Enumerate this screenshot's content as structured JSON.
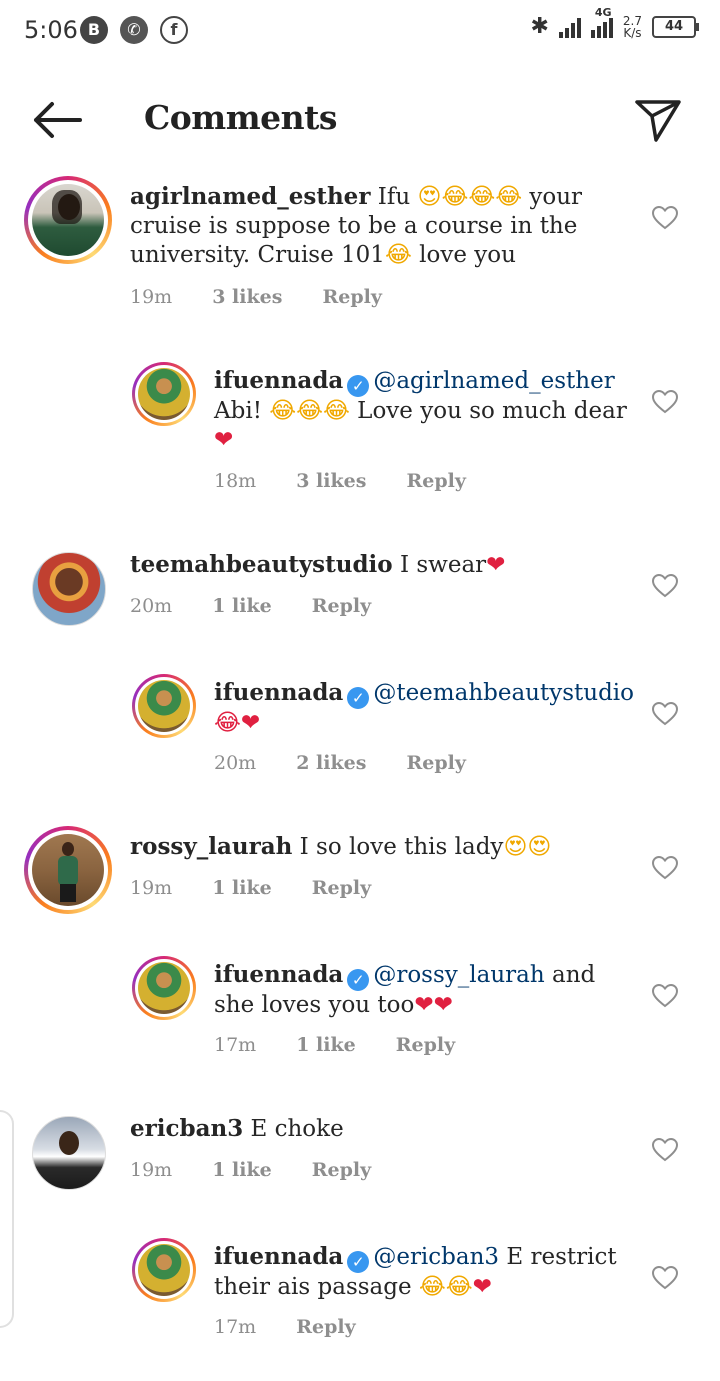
{
  "status_bar": {
    "time": "5:06",
    "icons": [
      "b-badge-icon",
      "whatsapp-icon",
      "facebook-icon"
    ],
    "network_label": "4G",
    "speed": "2.7",
    "speed_unit": "K/s",
    "battery": "44"
  },
  "header": {
    "title": "Comments"
  },
  "comments": [
    {
      "username": "agirlnamed_esther",
      "text_1": "Ifu ",
      "emoji_1": "😍😂😂😂",
      "text_2": " your cruise is suppose to be a course in the university. Cruise 101",
      "emoji_2": "😂",
      "text_3": " love you",
      "time": "19m",
      "likes": "3 likes",
      "reply": "Reply"
    },
    {
      "username": "ifuennada",
      "mention": "@agirlnamed_esther",
      "text_1": "Abi! ",
      "emoji_1": "😂😂😂",
      "text_2": " Love you so much dear ",
      "emoji_2": "❤",
      "time": "18m",
      "likes": "3 likes",
      "reply": "Reply"
    },
    {
      "username": "teemahbeautystudio",
      "text_1": " I swear",
      "emoji_1": "❤",
      "time": "20m",
      "likes": "1 like",
      "reply": "Reply"
    },
    {
      "username": "ifuennada",
      "mention": "@teemahbeautystudio",
      "emoji_1": "😂❤",
      "time": "20m",
      "likes": "2 likes",
      "reply": "Reply"
    },
    {
      "username": "rossy_laurah",
      "text_1": " I so love this lady",
      "emoji_1": "😍😍",
      "time": "19m",
      "likes": "1 like",
      "reply": "Reply"
    },
    {
      "username": "ifuennada",
      "mention": "@rossy_laurah",
      "text_1": " and she loves you too",
      "emoji_1": "❤❤",
      "time": "17m",
      "likes": "1 like",
      "reply": "Reply"
    },
    {
      "username": "ericban3",
      "text_1": " E choke",
      "time": "19m",
      "likes": "1 like",
      "reply": "Reply"
    },
    {
      "username": "ifuennada",
      "mention": "@ericban3",
      "text_1": " E restrict their ais passage ",
      "emoji_1": "😂😂",
      "emoji_2": "❤",
      "time": "17m",
      "reply": "Reply"
    }
  ]
}
